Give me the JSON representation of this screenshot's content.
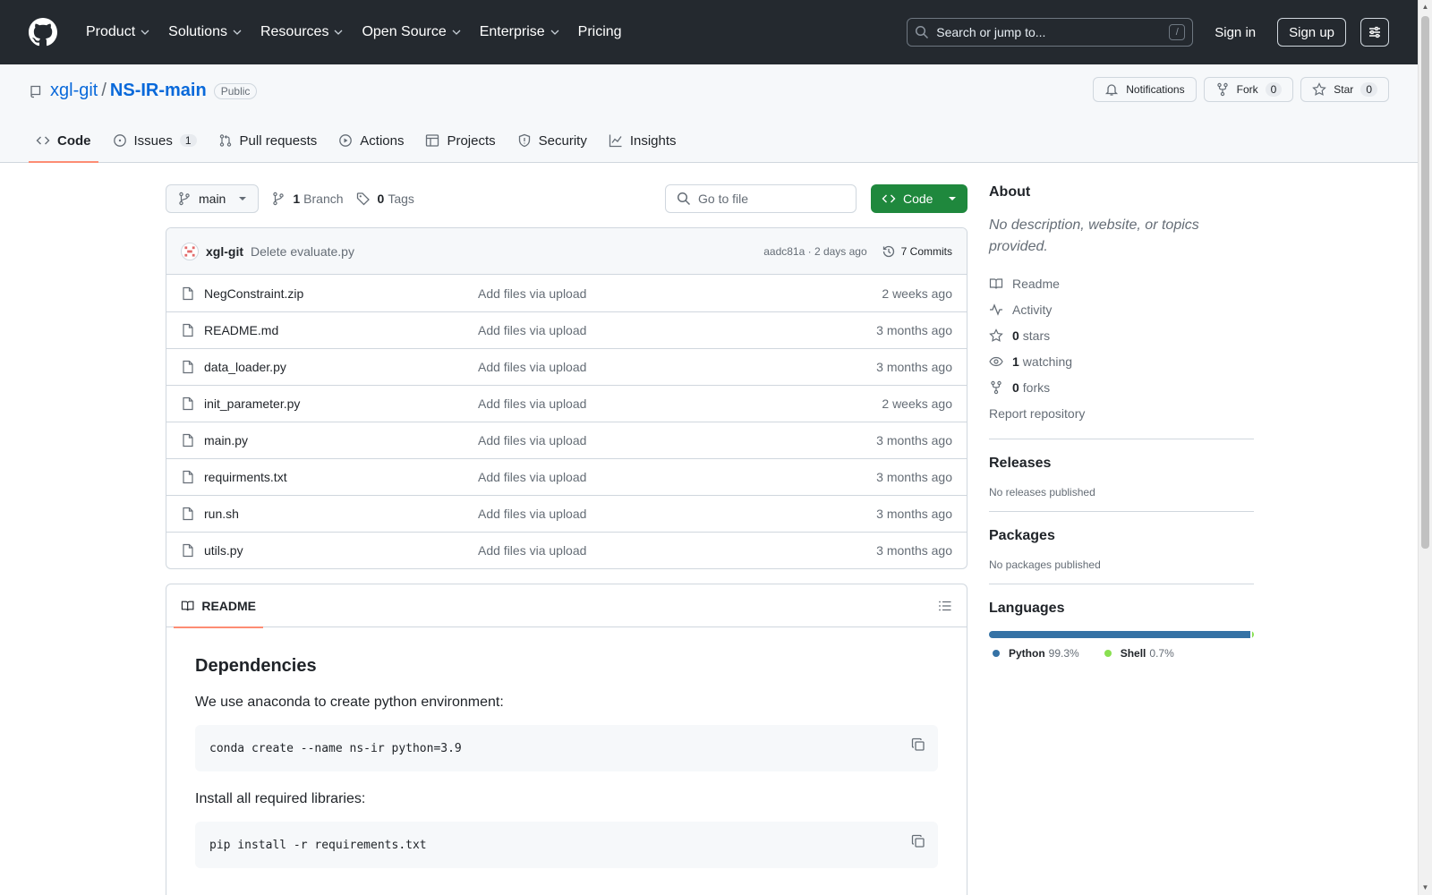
{
  "header": {
    "nav": [
      {
        "label": "Product",
        "has_menu": true
      },
      {
        "label": "Solutions",
        "has_menu": true
      },
      {
        "label": "Resources",
        "has_menu": true
      },
      {
        "label": "Open Source",
        "has_menu": true
      },
      {
        "label": "Enterprise",
        "has_menu": true
      },
      {
        "label": "Pricing",
        "has_menu": false
      }
    ],
    "search_placeholder": "Search or jump to...",
    "search_shortcut": "/",
    "sign_in": "Sign in",
    "sign_up": "Sign up"
  },
  "repo": {
    "owner": "xgl-git",
    "separator": "/",
    "name": "NS-IR-main",
    "visibility": "Public",
    "notifications_label": "Notifications",
    "fork_label": "Fork",
    "fork_count": "0",
    "star_label": "Star",
    "star_count": "0",
    "tabs": [
      {
        "label": "Code",
        "icon": "code-icon",
        "active": true
      },
      {
        "label": "Issues",
        "icon": "issue-icon",
        "count": "1"
      },
      {
        "label": "Pull requests",
        "icon": "pull-request-icon"
      },
      {
        "label": "Actions",
        "icon": "play-icon"
      },
      {
        "label": "Projects",
        "icon": "table-icon"
      },
      {
        "label": "Security",
        "icon": "shield-icon"
      },
      {
        "label": "Insights",
        "icon": "graph-icon"
      }
    ]
  },
  "toolbar": {
    "branch": "main",
    "branch_count": "1",
    "branch_label": "Branch",
    "tag_count": "0",
    "tag_label": "Tags",
    "goto_placeholder": "Go to file",
    "code_button": "Code"
  },
  "latest_commit": {
    "author": "xgl-git",
    "message": "Delete evaluate.py",
    "meta": "aadc81a · 2 days ago",
    "commits_label": "7 Commits"
  },
  "files": [
    {
      "name": "NegConstraint.zip",
      "message": "Add files via upload",
      "age": "2 weeks ago"
    },
    {
      "name": "README.md",
      "message": "Add files via upload",
      "age": "3 months ago"
    },
    {
      "name": "data_loader.py",
      "message": "Add files via upload",
      "age": "3 months ago"
    },
    {
      "name": "init_parameter.py",
      "message": "Add files via upload",
      "age": "2 weeks ago"
    },
    {
      "name": "main.py",
      "message": "Add files via upload",
      "age": "3 months ago"
    },
    {
      "name": "requirments.txt",
      "message": "Add files via upload",
      "age": "3 months ago"
    },
    {
      "name": "run.sh",
      "message": "Add files via upload",
      "age": "3 months ago"
    },
    {
      "name": "utils.py",
      "message": "Add files via upload",
      "age": "3 months ago"
    }
  ],
  "readme": {
    "tab_label": "README",
    "heading": "Dependencies",
    "p1": "We use anaconda to create python environment:",
    "code1": "conda create --name ns-ir python=3.9",
    "p2": "Install all required libraries:",
    "code2": "pip install -r requirements.txt"
  },
  "sidebar": {
    "about_title": "About",
    "about_desc": "No description, website, or topics provided.",
    "readme": "Readme",
    "activity": "Activity",
    "stars_count": "0",
    "stars_label": "stars",
    "watching_count": "1",
    "watching_label": "watching",
    "forks_count": "0",
    "forks_label": "forks",
    "report": "Report repository",
    "releases_title": "Releases",
    "releases_empty": "No releases published",
    "packages_title": "Packages",
    "packages_empty": "No packages published",
    "languages_title": "Languages",
    "languages": [
      {
        "name": "Python",
        "percent": "99.3%",
        "value": 99.3,
        "color": "#3572a5"
      },
      {
        "name": "Shell",
        "percent": "0.7%",
        "value": 0.7,
        "color": "#89e051"
      }
    ]
  }
}
